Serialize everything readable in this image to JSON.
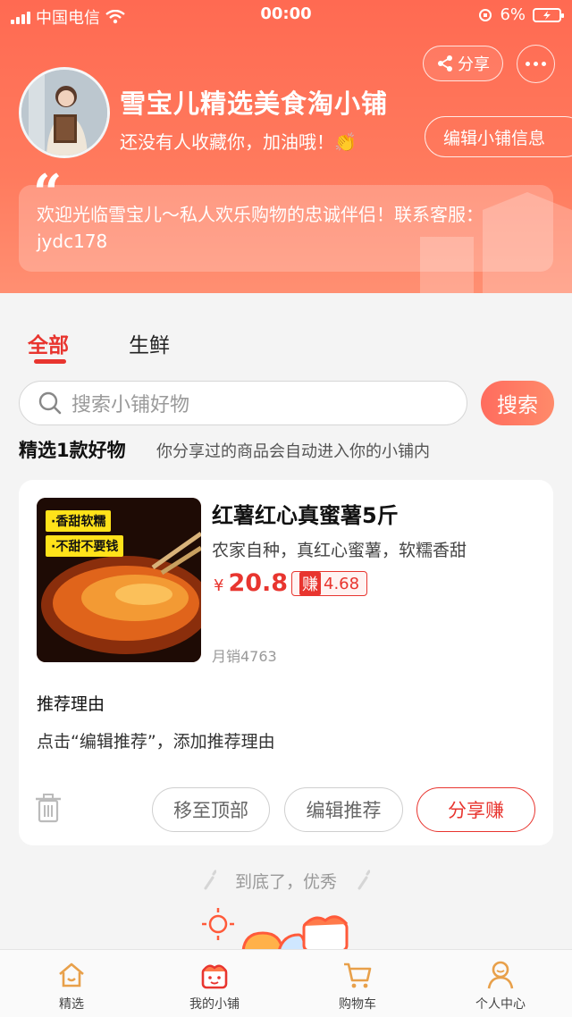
{
  "status_bar": {
    "carrier": "中国电信",
    "time": "00:00",
    "battery": "6%"
  },
  "header": {
    "share_label": "分享",
    "shop_name": "雪宝儿精选美食淘小铺",
    "subtitle": "还没有人收藏你，加油哦！👏",
    "edit_info_label": "编辑小铺信息",
    "notice": "欢迎光临雪宝儿～私人欢乐购物的忠诚伴侣！联系客服：jydc178"
  },
  "tabs": [
    {
      "label": "全部",
      "active": true
    },
    {
      "label": "生鲜",
      "active": false
    }
  ],
  "search": {
    "placeholder": "搜索小铺好物",
    "button_label": "搜索"
  },
  "section": {
    "title": "精选1款好物",
    "hint": "你分享过的商品会自动进入你的小铺内"
  },
  "product": {
    "image_tags": [
      "·香甜软糯",
      "·不甜不要钱"
    ],
    "title": "红薯红心真蜜薯5斤",
    "description": "农家自种，真红心蜜薯，软糯香甜",
    "currency": "¥",
    "price": "20.8",
    "earn_prefix": "赚",
    "earn_value": "4.68",
    "monthly_sales": "月销4763",
    "reason_title": "推荐理由",
    "reason_text": "点击“编辑推荐”，添加推荐理由",
    "btn_move_top": "移至顶部",
    "btn_edit": "编辑推荐",
    "btn_share": "分享赚"
  },
  "footer_note": "到底了，优秀",
  "tabbar": [
    {
      "label": "精选",
      "icon": "home-icon"
    },
    {
      "label": "我的小铺",
      "icon": "shop-icon"
    },
    {
      "label": "购物车",
      "icon": "cart-icon"
    },
    {
      "label": "个人中心",
      "icon": "person-icon"
    }
  ],
  "colors": {
    "accent": "#e8352f",
    "header_gradient_top": "#ff6a52",
    "tabbar_icon": "#e8a04a"
  }
}
